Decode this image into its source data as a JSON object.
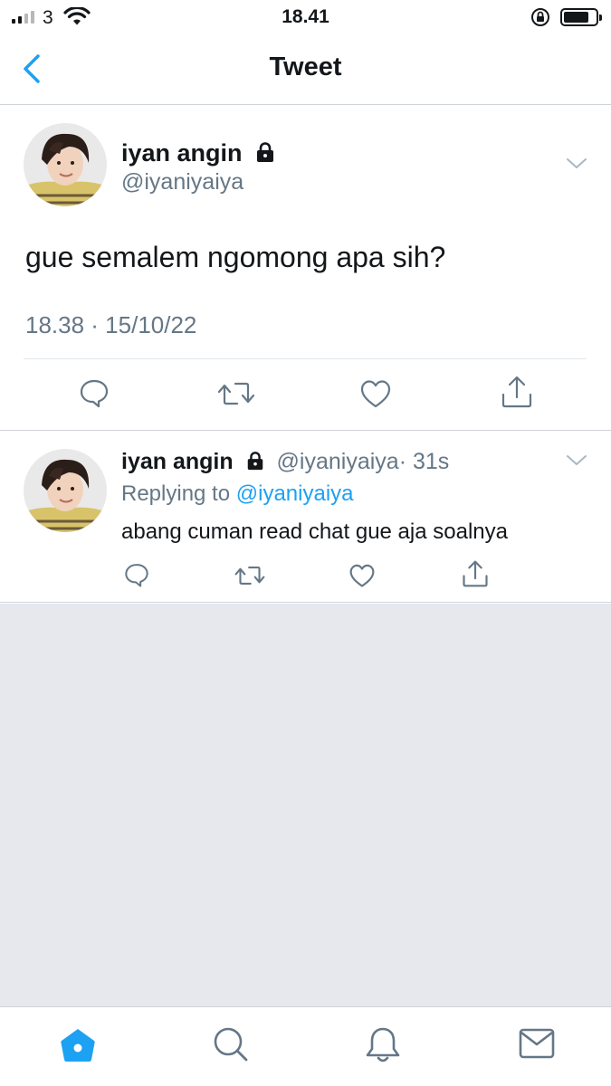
{
  "status_bar": {
    "carrier": "3",
    "time": "18.41",
    "signal_bars_active": 2,
    "battery_level_percent": 80
  },
  "nav": {
    "title": "Tweet",
    "accent_color": "#1da1f2"
  },
  "main_tweet": {
    "display_name": "iyan angin",
    "handle": "@iyaniyaiya",
    "text": "gue semalem ngomong apa sih?",
    "timestamp": "18.38 · 15/10/22",
    "actions": [
      "reply-icon",
      "retweet-icon",
      "like-icon",
      "share-icon"
    ]
  },
  "reply_tweet": {
    "display_name": "iyan angin",
    "handle": "@iyaniyaiya",
    "age": "· 31s",
    "replying_prefix": "Replying to",
    "replying_to": "@iyaniyaiya",
    "text": "abang cuman read chat gue aja soalnya",
    "actions": [
      "reply-icon",
      "retweet-icon",
      "like-icon",
      "share-icon"
    ]
  },
  "tab_bar": {
    "items": [
      "home-icon",
      "search-icon",
      "notifications-icon",
      "messages-icon"
    ],
    "active": "home-icon"
  },
  "colors": {
    "accent": "#1da1f2",
    "secondary_text": "#657786",
    "divider": "#cfd4d9",
    "empty_background": "#e6e8ee"
  }
}
